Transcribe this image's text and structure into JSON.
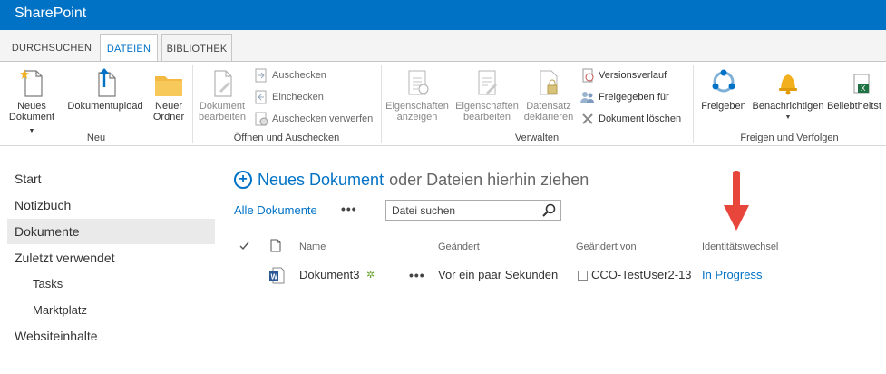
{
  "suite": {
    "brand": "SharePoint"
  },
  "tabs": [
    {
      "label": "DURCHSUCHEN",
      "active": false
    },
    {
      "label": "DATEIEN",
      "active": true
    },
    {
      "label": "BIBLIOTHEK",
      "active": false
    }
  ],
  "ribbon": {
    "neu": {
      "group_label": "Neu",
      "neues_dokument_line1": "Neues",
      "neues_dokument_line2": "Dokument",
      "upload": "Dokumentupload",
      "ordner_line1": "Neuer",
      "ordner_line2": "Ordner"
    },
    "oeffnen": {
      "group_label": "Öffnen und Auschecken",
      "bearbeiten_line1": "Dokument",
      "bearbeiten_line2": "bearbeiten",
      "auschecken": "Auschecken",
      "einchecken": "Einchecken",
      "verwerfen": "Auschecken verwerfen"
    },
    "verwalten": {
      "group_label": "Verwalten",
      "eig_anzeigen_line1": "Eigenschaften",
      "eig_anzeigen_line2": "anzeigen",
      "eig_bearbeiten_line1": "Eigenschaften",
      "eig_bearbeiten_line2": "bearbeiten",
      "datensatz_line1": "Datensatz",
      "datensatz_line2": "deklarieren",
      "versionsverlauf": "Versionsverlauf",
      "freigegeben": "Freigegeben für",
      "loeschen": "Dokument löschen"
    },
    "freigeben": {
      "group_label": "Freigen und Verfolgen",
      "freigeben": "Freigeben",
      "benachrichtigen": "Benachrichtigen",
      "beliebtheit": "Beliebtheitst"
    }
  },
  "nav": {
    "items": [
      {
        "label": "Start"
      },
      {
        "label": "Notizbuch"
      },
      {
        "label": "Dokumente"
      },
      {
        "label": "Zuletzt verwendet"
      },
      {
        "label": "Tasks"
      },
      {
        "label": "Marktplatz"
      },
      {
        "label": "Websiteinhalte"
      }
    ]
  },
  "main": {
    "new_doc_link": "Neues Dokument",
    "new_doc_rest": "oder Dateien hierhin ziehen",
    "view": "Alle Dokumente",
    "ellipsis": "•••",
    "search_placeholder": "Datei suchen",
    "columns": {
      "name": "Name",
      "modified": "Geändert",
      "modified_by": "Geändert von",
      "identity": "Identitätswechsel"
    },
    "rows": [
      {
        "name": "Dokument3",
        "new_marker": "✲",
        "modified": "Vor ein paar Sekunden",
        "modified_by": "CCO-TestUser2-13",
        "identity": "In Progress"
      }
    ]
  },
  "colors": {
    "suite": "#0072c6",
    "link": "#0072c6",
    "arrow": "#e8463a",
    "new_marker": "#6aa32f"
  }
}
